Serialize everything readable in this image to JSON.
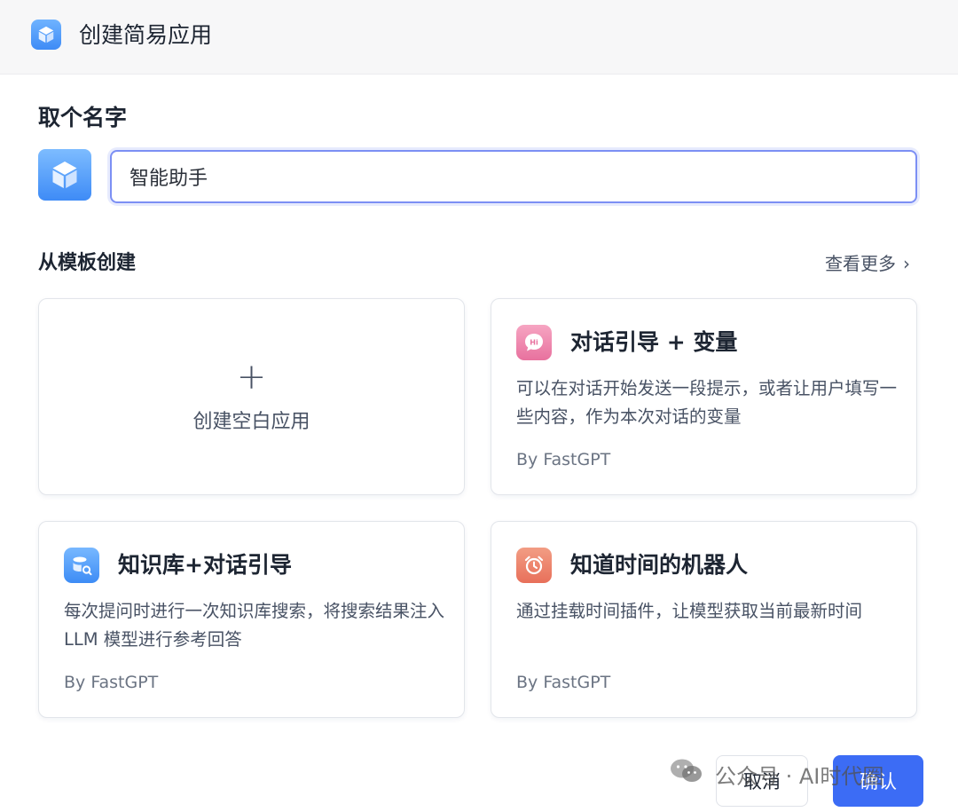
{
  "header": {
    "title": "创建简易应用",
    "icon": "cube-icon"
  },
  "name_section": {
    "label": "取个名字",
    "avatar_icon": "cube-icon",
    "input_value": "智能助手"
  },
  "templates": {
    "label": "从模板创建",
    "see_more": "查看更多",
    "blank": {
      "plus": "+",
      "label": "创建空白应用"
    },
    "cards": [
      {
        "icon": "hi-chat-icon",
        "title": "对话引导 + 变量",
        "desc": "可以在对话开始发送一段提示，或者让用户填写一些内容，作为本次对话的变量",
        "by": "By FastGPT"
      },
      {
        "icon": "database-search-icon",
        "title": "知识库+对话引导",
        "desc": "每次提问时进行一次知识库搜索，将搜索结果注入 LLM 模型进行参考回答",
        "by": "By FastGPT"
      },
      {
        "icon": "alarm-clock-icon",
        "title": "知道时间的机器人",
        "desc": "通过挂载时间插件，让模型获取当前最新时间",
        "by": "By FastGPT"
      }
    ]
  },
  "footer": {
    "cancel_label": "取消",
    "confirm_label": "确认"
  },
  "watermark": {
    "text": "公众号 · AI时代圈"
  },
  "colors": {
    "primary": "#3c6cf5",
    "input_border": "#7c8ff4",
    "text": "#1d2532",
    "muted": "#485264"
  }
}
